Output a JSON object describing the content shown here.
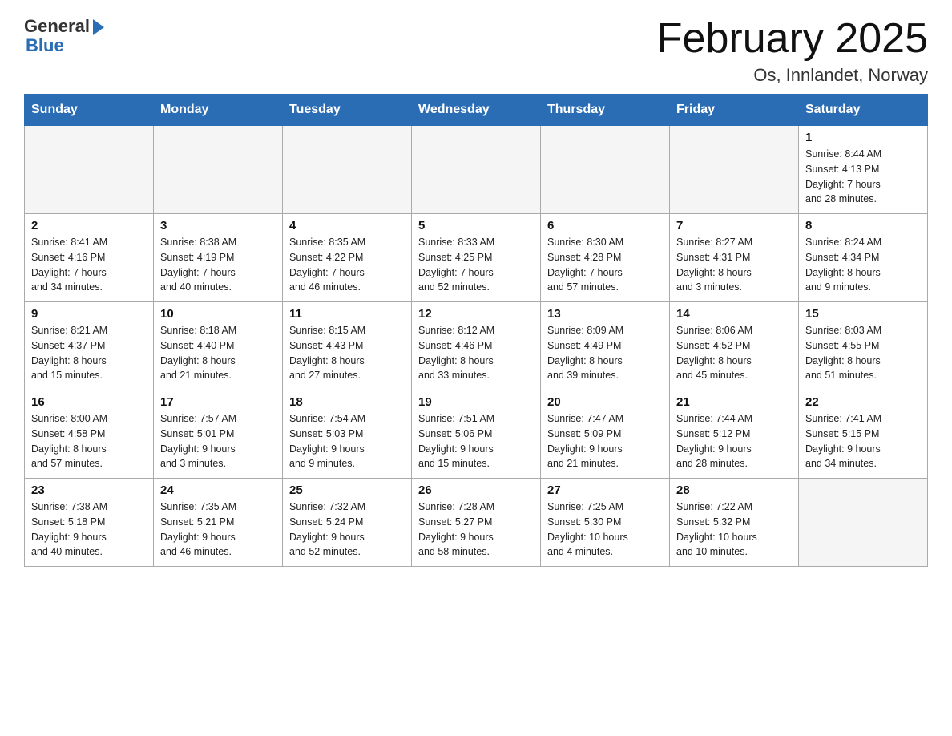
{
  "logo": {
    "general": "General",
    "blue": "Blue"
  },
  "header": {
    "title": "February 2025",
    "location": "Os, Innlandet, Norway"
  },
  "weekdays": [
    "Sunday",
    "Monday",
    "Tuesday",
    "Wednesday",
    "Thursday",
    "Friday",
    "Saturday"
  ],
  "weeks": [
    [
      {
        "day": "",
        "info": ""
      },
      {
        "day": "",
        "info": ""
      },
      {
        "day": "",
        "info": ""
      },
      {
        "day": "",
        "info": ""
      },
      {
        "day": "",
        "info": ""
      },
      {
        "day": "",
        "info": ""
      },
      {
        "day": "1",
        "info": "Sunrise: 8:44 AM\nSunset: 4:13 PM\nDaylight: 7 hours\nand 28 minutes."
      }
    ],
    [
      {
        "day": "2",
        "info": "Sunrise: 8:41 AM\nSunset: 4:16 PM\nDaylight: 7 hours\nand 34 minutes."
      },
      {
        "day": "3",
        "info": "Sunrise: 8:38 AM\nSunset: 4:19 PM\nDaylight: 7 hours\nand 40 minutes."
      },
      {
        "day": "4",
        "info": "Sunrise: 8:35 AM\nSunset: 4:22 PM\nDaylight: 7 hours\nand 46 minutes."
      },
      {
        "day": "5",
        "info": "Sunrise: 8:33 AM\nSunset: 4:25 PM\nDaylight: 7 hours\nand 52 minutes."
      },
      {
        "day": "6",
        "info": "Sunrise: 8:30 AM\nSunset: 4:28 PM\nDaylight: 7 hours\nand 57 minutes."
      },
      {
        "day": "7",
        "info": "Sunrise: 8:27 AM\nSunset: 4:31 PM\nDaylight: 8 hours\nand 3 minutes."
      },
      {
        "day": "8",
        "info": "Sunrise: 8:24 AM\nSunset: 4:34 PM\nDaylight: 8 hours\nand 9 minutes."
      }
    ],
    [
      {
        "day": "9",
        "info": "Sunrise: 8:21 AM\nSunset: 4:37 PM\nDaylight: 8 hours\nand 15 minutes."
      },
      {
        "day": "10",
        "info": "Sunrise: 8:18 AM\nSunset: 4:40 PM\nDaylight: 8 hours\nand 21 minutes."
      },
      {
        "day": "11",
        "info": "Sunrise: 8:15 AM\nSunset: 4:43 PM\nDaylight: 8 hours\nand 27 minutes."
      },
      {
        "day": "12",
        "info": "Sunrise: 8:12 AM\nSunset: 4:46 PM\nDaylight: 8 hours\nand 33 minutes."
      },
      {
        "day": "13",
        "info": "Sunrise: 8:09 AM\nSunset: 4:49 PM\nDaylight: 8 hours\nand 39 minutes."
      },
      {
        "day": "14",
        "info": "Sunrise: 8:06 AM\nSunset: 4:52 PM\nDaylight: 8 hours\nand 45 minutes."
      },
      {
        "day": "15",
        "info": "Sunrise: 8:03 AM\nSunset: 4:55 PM\nDaylight: 8 hours\nand 51 minutes."
      }
    ],
    [
      {
        "day": "16",
        "info": "Sunrise: 8:00 AM\nSunset: 4:58 PM\nDaylight: 8 hours\nand 57 minutes."
      },
      {
        "day": "17",
        "info": "Sunrise: 7:57 AM\nSunset: 5:01 PM\nDaylight: 9 hours\nand 3 minutes."
      },
      {
        "day": "18",
        "info": "Sunrise: 7:54 AM\nSunset: 5:03 PM\nDaylight: 9 hours\nand 9 minutes."
      },
      {
        "day": "19",
        "info": "Sunrise: 7:51 AM\nSunset: 5:06 PM\nDaylight: 9 hours\nand 15 minutes."
      },
      {
        "day": "20",
        "info": "Sunrise: 7:47 AM\nSunset: 5:09 PM\nDaylight: 9 hours\nand 21 minutes."
      },
      {
        "day": "21",
        "info": "Sunrise: 7:44 AM\nSunset: 5:12 PM\nDaylight: 9 hours\nand 28 minutes."
      },
      {
        "day": "22",
        "info": "Sunrise: 7:41 AM\nSunset: 5:15 PM\nDaylight: 9 hours\nand 34 minutes."
      }
    ],
    [
      {
        "day": "23",
        "info": "Sunrise: 7:38 AM\nSunset: 5:18 PM\nDaylight: 9 hours\nand 40 minutes."
      },
      {
        "day": "24",
        "info": "Sunrise: 7:35 AM\nSunset: 5:21 PM\nDaylight: 9 hours\nand 46 minutes."
      },
      {
        "day": "25",
        "info": "Sunrise: 7:32 AM\nSunset: 5:24 PM\nDaylight: 9 hours\nand 52 minutes."
      },
      {
        "day": "26",
        "info": "Sunrise: 7:28 AM\nSunset: 5:27 PM\nDaylight: 9 hours\nand 58 minutes."
      },
      {
        "day": "27",
        "info": "Sunrise: 7:25 AM\nSunset: 5:30 PM\nDaylight: 10 hours\nand 4 minutes."
      },
      {
        "day": "28",
        "info": "Sunrise: 7:22 AM\nSunset: 5:32 PM\nDaylight: 10 hours\nand 10 minutes."
      },
      {
        "day": "",
        "info": ""
      }
    ]
  ]
}
